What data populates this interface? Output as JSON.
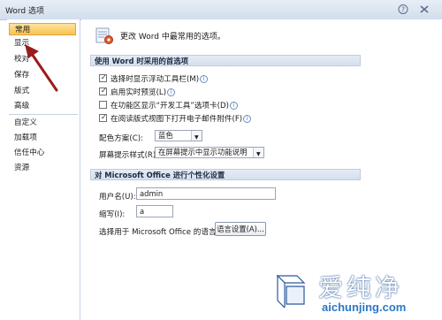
{
  "window": {
    "title": "Word 选项"
  },
  "sidebar": {
    "items": [
      {
        "label": "常用"
      },
      {
        "label": "显示"
      },
      {
        "label": "校对"
      },
      {
        "label": "保存"
      },
      {
        "label": "版式"
      },
      {
        "label": "高级"
      },
      {
        "label": "自定义"
      },
      {
        "label": "加载项"
      },
      {
        "label": "信任中心"
      },
      {
        "label": "资源"
      }
    ]
  },
  "main": {
    "header_text": "更改 Word 中最常用的选项。",
    "section_top": "使用 Word 时采用的首选项",
    "options": [
      {
        "label": "选择时显示浮动工具栏(M)",
        "checked": true
      },
      {
        "label": "启用实时预览(L)",
        "checked": true
      },
      {
        "label": "在功能区显示“开发工具”选项卡(D)",
        "checked": false
      },
      {
        "label": "在阅读版式视图下打开电子邮件附件(F)",
        "checked": true
      }
    ],
    "color_scheme": {
      "label": "配色方案(C):",
      "value": "蓝色"
    },
    "tooltip_style": {
      "label": "屏幕提示样式(R):",
      "value": "在屏幕提示中显示功能说明"
    },
    "section_personal": "对 Microsoft Office 进行个性化设置",
    "username": {
      "label": "用户名(U):",
      "value": "admin"
    },
    "initials": {
      "label": "缩写(I):",
      "value": "a"
    },
    "language": {
      "label": "选择用于 Microsoft Office 的语言:",
      "button": "语言设置(A)..."
    }
  },
  "watermark": {
    "brand": "爱纯净",
    "url": "aichunjing.com"
  },
  "colors": {
    "active_tab": "#f9c24f",
    "section_bg": "#d4dfee",
    "annotation_arrow": "#9b1c1c",
    "watermark_blue": "#2a78c8"
  }
}
